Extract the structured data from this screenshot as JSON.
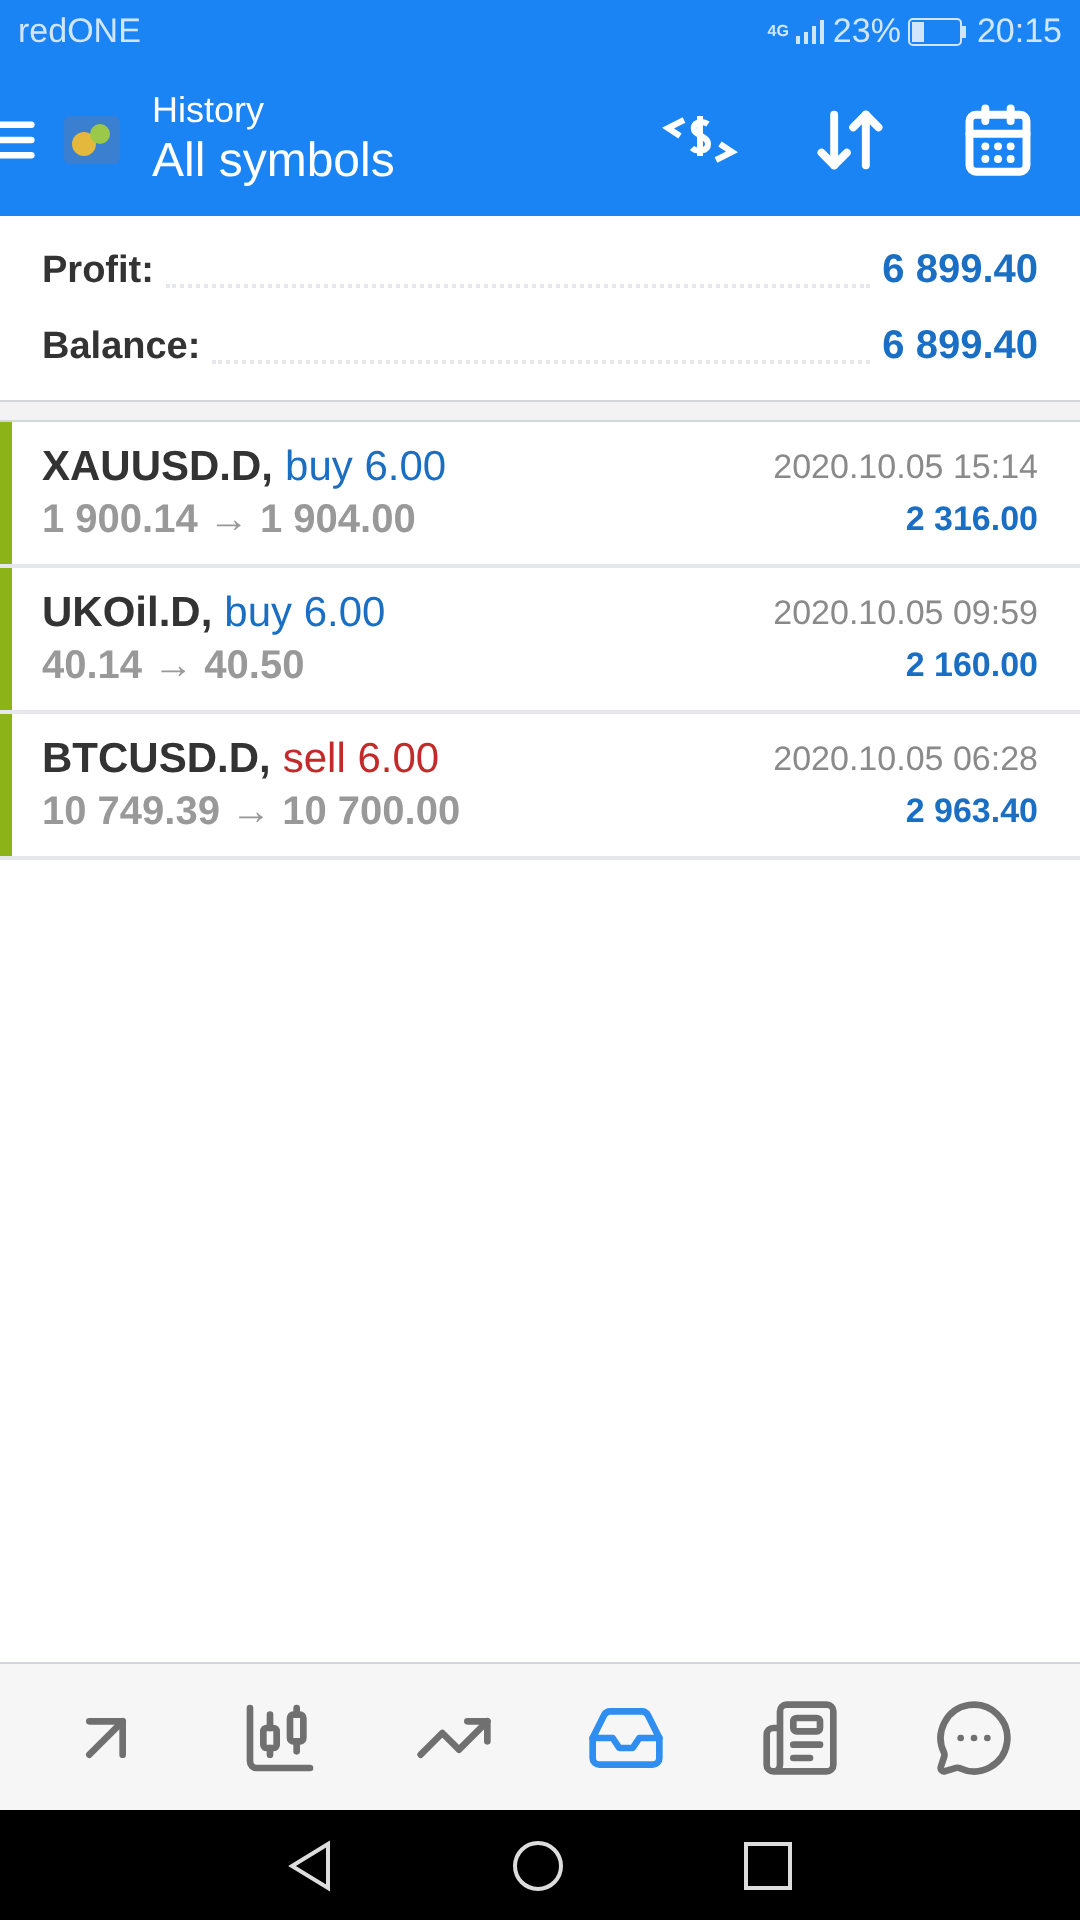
{
  "status_bar": {
    "carrier": "redONE",
    "network": "4G",
    "battery": "23%",
    "time": "20:15"
  },
  "header": {
    "subtitle": "History",
    "title": "All symbols"
  },
  "summary": [
    {
      "label": "Profit:",
      "value": "6 899.40"
    },
    {
      "label": "Balance:",
      "value": "6 899.40"
    }
  ],
  "trades": [
    {
      "symbol": "XAUUSD.D,",
      "type": "buy",
      "volume": "6.00",
      "prices": "1 900.14 → 1 904.00",
      "time": "2020.10.05 15:14",
      "profit": "2 316.00"
    },
    {
      "symbol": "UKOil.D,",
      "type": "buy",
      "volume": "6.00",
      "prices": "40.14 → 40.50",
      "time": "2020.10.05 09:59",
      "profit": "2 160.00"
    },
    {
      "symbol": "BTCUSD.D,",
      "type": "sell",
      "volume": "6.00",
      "prices": "10 749.39 → 10 700.00",
      "time": "2020.10.05 06:28",
      "profit": "2 963.40"
    }
  ],
  "bottom_nav": [
    {
      "kind": "quotes",
      "selected": false
    },
    {
      "kind": "chart",
      "selected": false
    },
    {
      "kind": "trade",
      "selected": false
    },
    {
      "kind": "history",
      "selected": true
    },
    {
      "kind": "news",
      "selected": false
    },
    {
      "kind": "chat",
      "selected": false
    }
  ]
}
